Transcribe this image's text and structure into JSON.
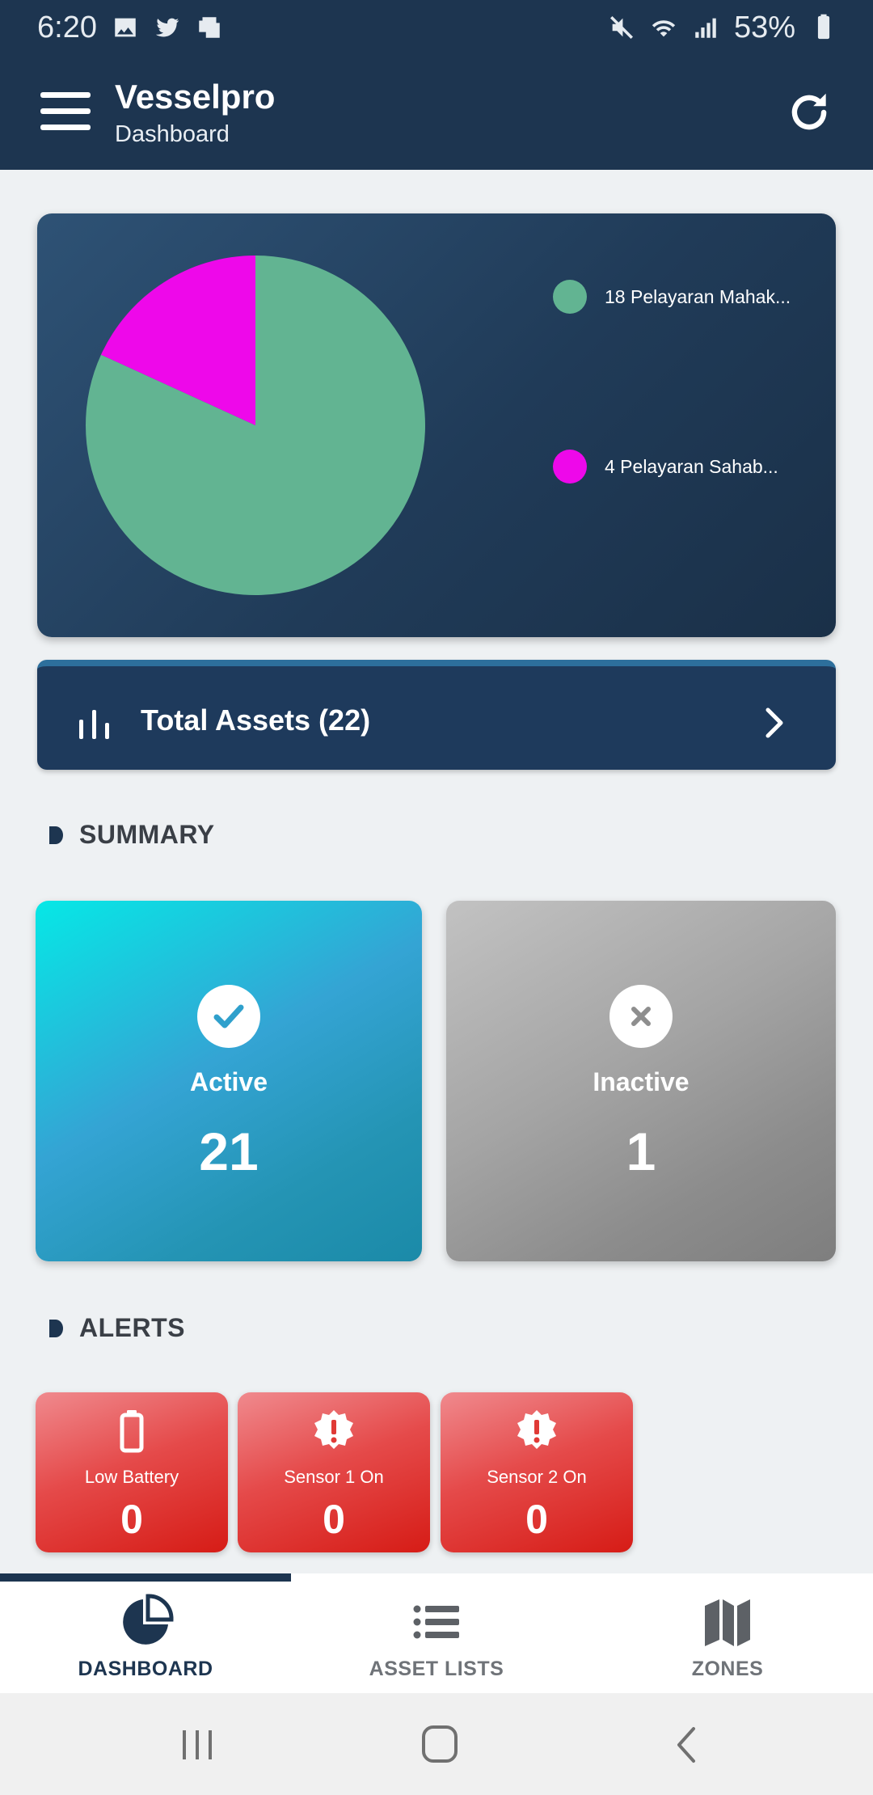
{
  "status_bar": {
    "time": "6:20",
    "battery": "53%"
  },
  "app_bar": {
    "title": "Vesselpro",
    "subtitle": "Dashboard"
  },
  "chart_data": {
    "type": "pie",
    "slices": [
      {
        "label": "18 Pelayaran Mahak...",
        "value": 18,
        "color": "#62b492"
      },
      {
        "label": "4 Pelayaran Sahab...",
        "value": 4,
        "color": "#ee08ea"
      }
    ],
    "legend": "right"
  },
  "total_assets": {
    "label": "Total Assets (22)"
  },
  "summary": {
    "title": "SUMMARY",
    "active": {
      "label": "Active",
      "value": "21"
    },
    "inactive": {
      "label": "Inactive",
      "value": "1"
    }
  },
  "alerts": {
    "title": "ALERTS",
    "items": [
      {
        "label": "Low Battery",
        "value": "0",
        "icon": "battery-icon"
      },
      {
        "label": "Sensor 1 On",
        "value": "0",
        "icon": "alert-badge-icon"
      },
      {
        "label": "Sensor 2 On",
        "value": "0",
        "icon": "alert-badge-icon"
      }
    ]
  },
  "bottom_nav": {
    "selected": "DASHBOARD",
    "items": [
      {
        "label": "DASHBOARD",
        "icon": "pie-chart-icon"
      },
      {
        "label": "ASSET LISTS",
        "icon": "list-icon"
      },
      {
        "label": "ZONES",
        "icon": "map-icon"
      }
    ]
  },
  "colors": {
    "primary": "#1d3550",
    "active_accent": "#06e8e6",
    "alert": "#d61c16"
  }
}
